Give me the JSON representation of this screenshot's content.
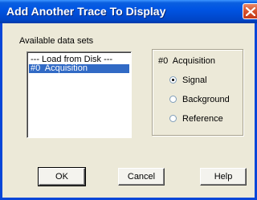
{
  "window": {
    "title": "Add Another Trace To Display"
  },
  "datasets": {
    "label": "Available data sets",
    "items": [
      {
        "label": "--- Load from Disk ---",
        "selected": false
      },
      {
        "label": "#0  Acquisition",
        "selected": true
      }
    ]
  },
  "trace_group": {
    "title": "#0  Acquisition",
    "options": [
      {
        "label": "Signal",
        "checked": true
      },
      {
        "label": "Background",
        "checked": false
      },
      {
        "label": "Reference",
        "checked": false
      }
    ]
  },
  "buttons": {
    "ok": "OK",
    "cancel": "Cancel",
    "help": "Help"
  },
  "colors": {
    "titlebar": "#0054e3",
    "selection": "#316ac5",
    "close_button": "#d6502a",
    "dialog_bg": "#ece9d8"
  },
  "icons": {
    "close": "close-x-icon"
  }
}
